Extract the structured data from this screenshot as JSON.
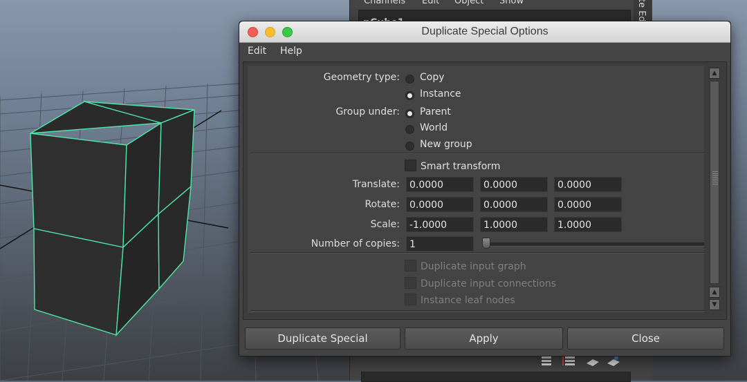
{
  "background_panel": {
    "menu": [
      "Channels",
      "Edit",
      "Object",
      "Show"
    ],
    "object_name": "pCube1",
    "side_tab": "te Ed"
  },
  "dialog": {
    "title": "Duplicate Special Options",
    "menu": {
      "edit": "Edit",
      "help": "Help"
    },
    "geometry_type": {
      "label": "Geometry type:",
      "options": [
        "Copy",
        "Instance"
      ],
      "selected": "Instance"
    },
    "group_under": {
      "label": "Group under:",
      "options": [
        "Parent",
        "World",
        "New group"
      ],
      "selected": "Parent"
    },
    "smart_transform": {
      "label": "Smart transform",
      "checked": false
    },
    "translate": {
      "label": "Translate:",
      "values": [
        "0.0000",
        "0.0000",
        "0.0000"
      ]
    },
    "rotate": {
      "label": "Rotate:",
      "values": [
        "0.0000",
        "0.0000",
        "0.0000"
      ]
    },
    "scale": {
      "label": "Scale:",
      "values": [
        "-1.0000",
        "1.0000",
        "1.0000"
      ]
    },
    "copies": {
      "label": "Number of copies:",
      "value": "1"
    },
    "duplicate_input_graph": {
      "label": "Duplicate input graph",
      "enabled": false
    },
    "duplicate_input_connections": {
      "label": "Duplicate input connections",
      "enabled": false
    },
    "instance_leaf_nodes": {
      "label": "Instance leaf nodes",
      "enabled": false
    },
    "buttons": {
      "duplicate": "Duplicate Special",
      "apply": "Apply",
      "close": "Close"
    }
  },
  "colors": {
    "wireframe": "#4fe6a8",
    "panel": "#444444",
    "viewport_top": "#8797ab",
    "viewport_bottom": "#3e3f43"
  }
}
